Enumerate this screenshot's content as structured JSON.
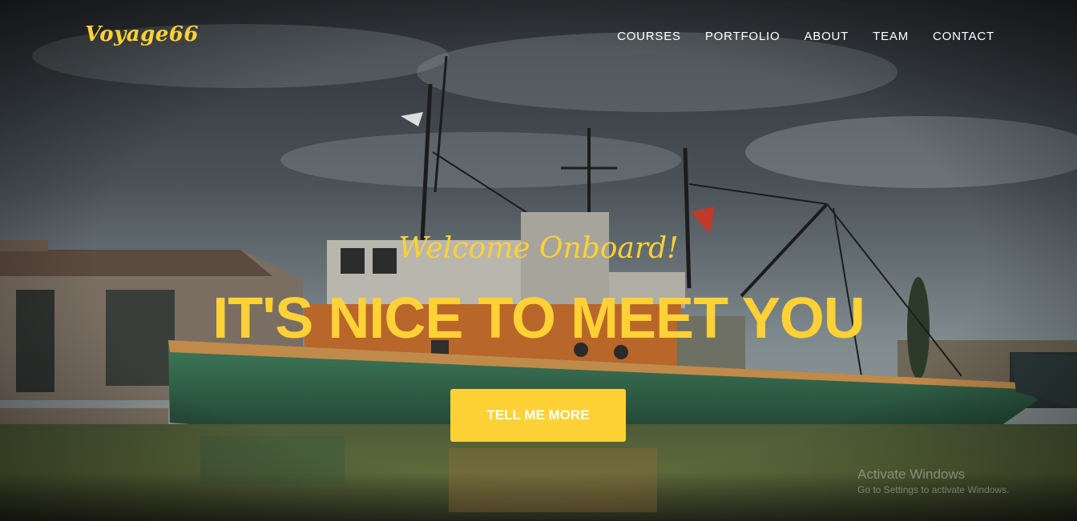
{
  "brand": {
    "name": "Voyage66",
    "color": "#fed136"
  },
  "nav": {
    "items": [
      {
        "label": "COURSES"
      },
      {
        "label": "PORTFOLIO"
      },
      {
        "label": "ABOUT"
      },
      {
        "label": "TEAM"
      },
      {
        "label": "CONTACT"
      }
    ]
  },
  "hero": {
    "lead_in": "Welcome Onboard!",
    "heading": "IT'S NICE TO MEET YOU",
    "cta_label": "TELL ME MORE",
    "background": "photo of a green and orange tugboat docked in a harbor under a cloudy sky",
    "accent_color": "#fed136"
  },
  "overlay": {
    "watermark_title": "Activate Windows",
    "watermark_subtitle": "Go to Settings to activate Windows."
  }
}
